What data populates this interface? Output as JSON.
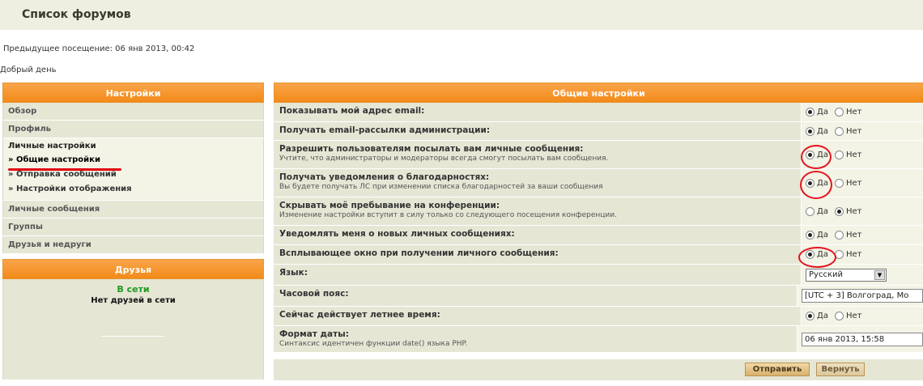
{
  "header": {
    "title": "Список форумов"
  },
  "last_visit": "Предыдущее посещение: 06 янв 2013, 00:42",
  "greeting": "Добрый день",
  "settings_panel": {
    "title": "Настройки",
    "items": [
      {
        "label": "Обзор"
      },
      {
        "label": "Профиль"
      }
    ],
    "active_section": {
      "label": "Личные настройки",
      "subitems": [
        {
          "label": "» Общие настройки"
        },
        {
          "label": "» Отправка сообщений"
        },
        {
          "label": "» Настройки отображения"
        }
      ]
    },
    "items_after": [
      {
        "label": "Личные сообщения"
      },
      {
        "label": "Группы"
      },
      {
        "label": "Друзья и недруги"
      }
    ]
  },
  "friends_panel": {
    "title": "Друзья",
    "online_label": "В сети",
    "empty_text": "Нет друзей в сети"
  },
  "general": {
    "title": "Общие настройки",
    "yes": "Да",
    "no": "Нет",
    "rows": [
      {
        "label": "Показывать мой адрес email:",
        "selected": "yes"
      },
      {
        "label": "Получать email-рассылки администрации:",
        "selected": "yes"
      },
      {
        "label": "Разрешить пользователям посылать вам личные сообщения:",
        "sub": "Учтите, что администраторы и модераторы всегда смогут посылать вам сообщения.",
        "selected": "yes"
      },
      {
        "label": "Получать уведомления о благодарностях:",
        "sub": "Вы будете получать ЛС при изменении списка благодарностей за ваши сообщения",
        "selected": "yes"
      },
      {
        "label": "Скрывать моё пребывание на конференции:",
        "sub": "Изменение настройки вступит в силу только со следующего посещения конференции.",
        "selected": "no"
      },
      {
        "label": "Уведомлять меня о новых личных сообщениях:",
        "selected": "yes"
      },
      {
        "label": "Всплывающее окно при получении личного сообщения:",
        "selected": "yes"
      }
    ],
    "language": {
      "label": "Язык:",
      "value": "Русский"
    },
    "timezone": {
      "label": "Часовой пояс:",
      "value": "[UTC + 3] Волгоград, Мо"
    },
    "dst": {
      "label": "Сейчас действует летнее время:",
      "selected": "yes"
    },
    "date_format": {
      "label": "Формат даты:",
      "sub": "Синтаксис идентичен функции date() языка PHP.",
      "value": "06 янв 2013, 15:58"
    }
  },
  "buttons": {
    "submit": "Отправить",
    "reset": "Вернуть"
  },
  "colors": {
    "accent_orange": "#f28a18",
    "panel_bg": "#e6e6d5",
    "annotation_red": "#e4141e",
    "online_green": "#1e9a1e"
  }
}
